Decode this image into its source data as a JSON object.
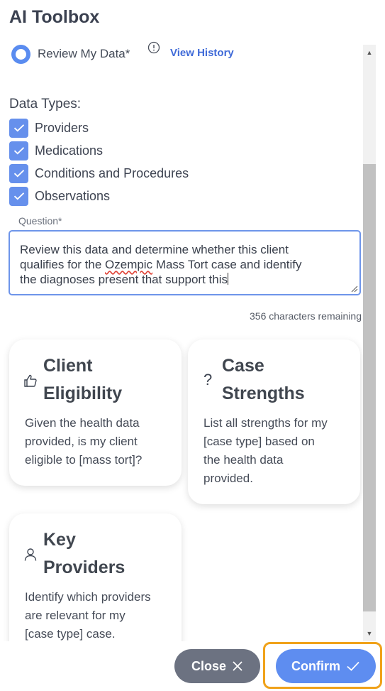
{
  "header": {
    "title": "AI Toolbox"
  },
  "review": {
    "label": "Review My Data*",
    "view_history": "View History"
  },
  "data_types": {
    "label": "Data Types:",
    "items": [
      {
        "label": "Providers",
        "checked": true
      },
      {
        "label": "Medications",
        "checked": true
      },
      {
        "label": "Conditions and Procedures",
        "checked": true
      },
      {
        "label": "Observations",
        "checked": true
      }
    ]
  },
  "question": {
    "label": "Question*",
    "line1": "Review this data and determine whether this client",
    "line2_pre": "qualifies for the ",
    "line2_flag": "Ozempic",
    "line2_post": " Mass Tort case and identify",
    "line3": "the diagnoses present that support this",
    "chars_remaining": "356 characters remaining"
  },
  "cards": [
    {
      "title_line1": "Client",
      "title_line2": "Eligibility",
      "icon": "thumbs-up-icon",
      "desc": [
        "Given the health data",
        "provided, is my client",
        "eligible to [mass tort]?"
      ]
    },
    {
      "title_line1": "Case",
      "title_line2": "Strengths",
      "icon": "question-icon",
      "desc": [
        "List all strengths for my",
        "[case type] based on",
        "the health data",
        "provided."
      ]
    },
    {
      "title_line1": "Key",
      "title_line2": "Providers",
      "icon": "person-icon",
      "desc": [
        "Identify which providers",
        "are relevant for my",
        "[case type] case."
      ]
    }
  ],
  "footer": {
    "close_label": "Close",
    "confirm_label": "Confirm"
  },
  "colors": {
    "accent": "#5e8df0",
    "highlight": "#f0a21a",
    "close_bg": "#6c7281"
  }
}
